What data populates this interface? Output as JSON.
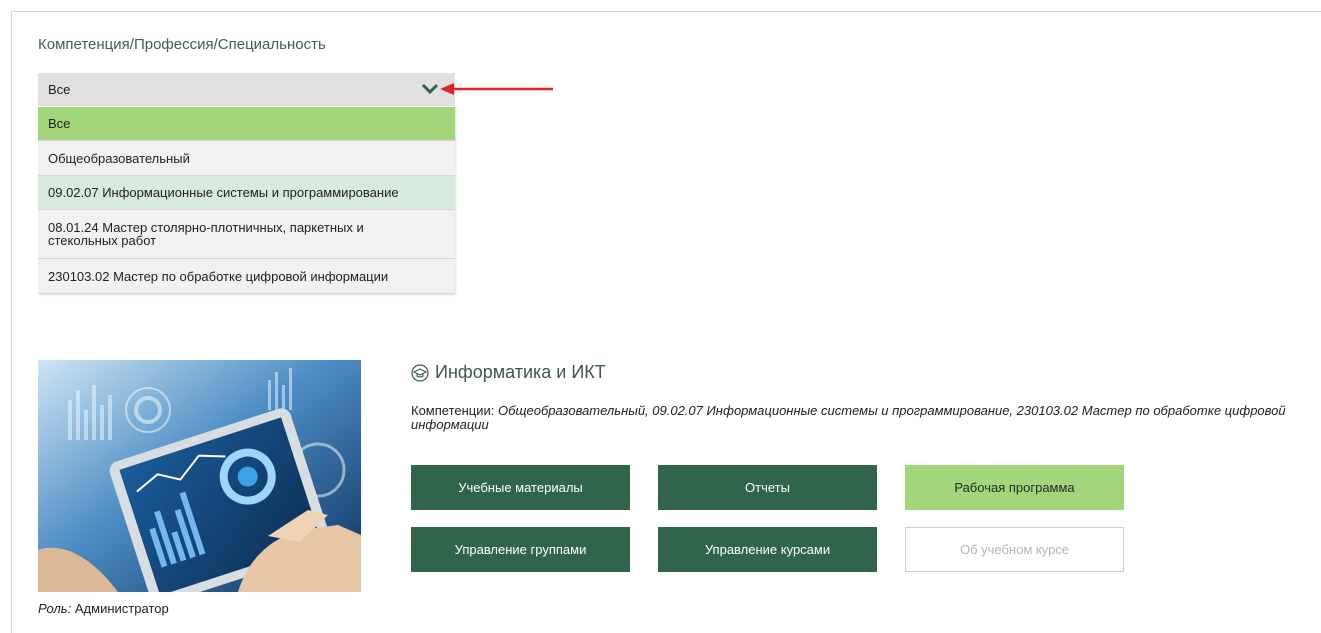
{
  "filter": {
    "label": "Компетенция/Профессия/Специальность",
    "selected": "Все",
    "options": [
      "Все",
      "Общеобразовательный",
      "09.02.07 Информационные системы и программирование",
      "08.01.24 Мастер столярно-плотничных, паркетных и стекольных работ",
      "230103.02 Мастер по обработке цифровой информации"
    ]
  },
  "course": {
    "title": "Информатика и ИКТ",
    "competencies_label": "Компетенции:",
    "competencies_value": "Общеобразовательный, 09.02.07 Информационные системы и программирование, 230103.02 Мастер по обработке цифровой информации",
    "role_label": "Роль:",
    "role_value": "Администратор",
    "buttons": {
      "materials": "Учебные материалы",
      "reports": "Отчеты",
      "program": "Рабочая программа",
      "groups": "Управление группами",
      "courses": "Управление курсами",
      "about": "Об учебном курсе"
    }
  },
  "colors": {
    "accent_dark": "#30654c",
    "accent_light": "#a3d57a",
    "hover": "#d6eadd",
    "arrow": "#e0232b"
  }
}
